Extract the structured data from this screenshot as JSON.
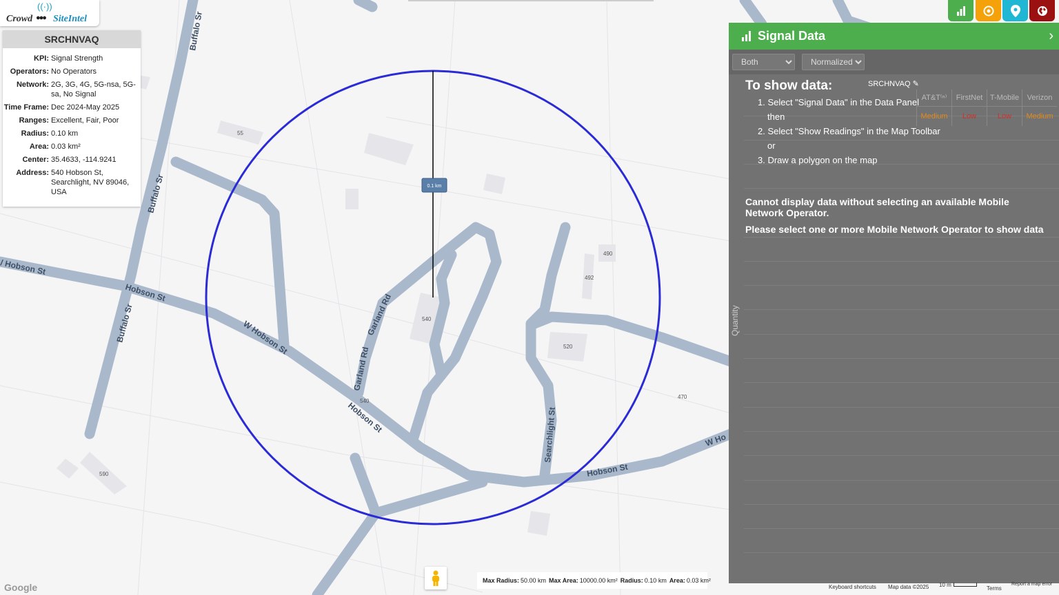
{
  "logo": {
    "part1": "Crowd",
    "part2": "SiteIntel",
    "wave": "((·))",
    "people": "👥👥"
  },
  "info": {
    "site_id": "SRCHNVAQ",
    "rows": [
      {
        "k": "KPI:",
        "v": "Signal Strength"
      },
      {
        "k": "Operators:",
        "v": "No Operators"
      },
      {
        "k": "Network:",
        "v": "2G, 3G, 4G, 5G-nsa, 5G-sa, No Signal"
      },
      {
        "k": "Time Frame:",
        "v": "Dec 2024-May 2025"
      },
      {
        "k": "Ranges:",
        "v": "Excellent, Fair, Poor"
      },
      {
        "k": "Radius:",
        "v": "0.10 km"
      },
      {
        "k": "Area:",
        "v": "0.03 km²"
      },
      {
        "k": "Center:",
        "v": "35.4633, -114.9241"
      },
      {
        "k": "Address:",
        "v": "540 Hobson St, Searchlight, NV 89046, USA"
      }
    ]
  },
  "toolbar": {
    "buttons": [
      {
        "name": "signal-data-button",
        "icon": "bar-chart-icon",
        "color": "#4cae4c"
      },
      {
        "name": "target-button",
        "icon": "target-icon",
        "color": "#f5a20a"
      },
      {
        "name": "location-button",
        "icon": "map-pin-icon",
        "color": "#1fb7d3"
      },
      {
        "name": "globe-button",
        "icon": "globe-icon",
        "color": "#9b1010"
      }
    ]
  },
  "panel": {
    "title": "Signal Data",
    "filter_mode": "Both",
    "filter_norm": "Normalized",
    "show_title": "To show data:",
    "step1": "1. Select \"Signal Data\" in the Data Panel",
    "then": "then",
    "step2": "2. Select \"Show Readings\" in the Map Toolbar",
    "or": "or",
    "step3": "3. Draw a polygon on the map",
    "warn1": "Cannot display data without selecting an available Mobile Network Operator.",
    "warn2": "Please select one or more Mobile Network Operator to show data",
    "site_tag": "SRCHNVAQ",
    "y_label": "Quantity",
    "operators": [
      {
        "name": "AT&T⁽ⁿ⁾",
        "level": "Medium",
        "color": "#e08a1e"
      },
      {
        "name": "FirstNet",
        "level": "Low",
        "color": "#d0302a"
      },
      {
        "name": "T-Mobile",
        "level": "Low",
        "color": "#d0302a"
      },
      {
        "name": "Verizon",
        "level": "Medium",
        "color": "#e08a1e"
      }
    ]
  },
  "map": {
    "roads": {
      "hobson_w": "W Hobson St",
      "hobson": "Hobson St",
      "w_hobson": "W Hobson St",
      "w_ho": "W Ho",
      "buffalo": "Buffalo Sr",
      "buffalo2": "Buffalo Sr",
      "buffalo3": "Buffalo Sr",
      "garland": "Garland Rd",
      "garland2": "Garland Rd",
      "searchlight": "Searchlight St",
      "hobson_left": "/ Hobson St"
    },
    "buildings": [
      "55",
      "540",
      "540",
      "490",
      "492",
      "520",
      "470",
      "590"
    ],
    "measure_label": "0.1 km",
    "circle_color": "#2b2bd6"
  },
  "stats": {
    "max_radius_label": "Max Radius:",
    "max_radius": "50.00 km",
    "max_area_label": "Max Area:",
    "max_area": "10000.00 km²",
    "radius_label": "Radius:",
    "radius": "0.10 km",
    "area_label": "Area:",
    "area": "0.03 km²"
  },
  "attribution": {
    "google": "Google",
    "keyboard": "Keyboard shortcuts",
    "mapdata": "Map data ©2025",
    "scale": "10 m",
    "terms": "Terms",
    "report": "Report a map error"
  }
}
